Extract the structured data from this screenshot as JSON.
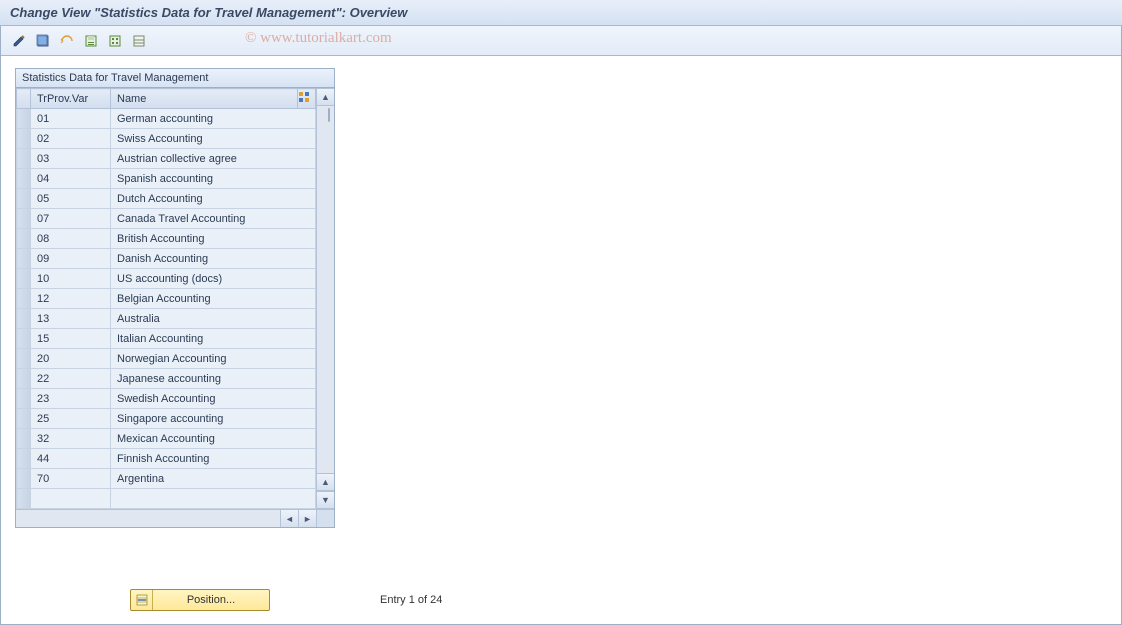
{
  "title": "Change View \"Statistics Data for Travel Management\": Overview",
  "watermark": "© www.tutorialkart.com",
  "panel": {
    "header": "Statistics Data for Travel Management",
    "columns": {
      "c1": "TrProv.Var",
      "c2": "Name"
    },
    "rows": [
      {
        "var": "01",
        "name": "German accounting"
      },
      {
        "var": "02",
        "name": "Swiss Accounting"
      },
      {
        "var": "03",
        "name": "Austrian collective agree"
      },
      {
        "var": "04",
        "name": "Spanish accounting"
      },
      {
        "var": "05",
        "name": "Dutch Accounting"
      },
      {
        "var": "07",
        "name": "Canada Travel Accounting"
      },
      {
        "var": "08",
        "name": "British Accounting"
      },
      {
        "var": "09",
        "name": "Danish Accounting"
      },
      {
        "var": "10",
        "name": "US accounting (docs)"
      },
      {
        "var": "12",
        "name": "Belgian Accounting"
      },
      {
        "var": "13",
        "name": "Australia"
      },
      {
        "var": "15",
        "name": "Italian Accounting"
      },
      {
        "var": "20",
        "name": "Norwegian Accounting"
      },
      {
        "var": "22",
        "name": "Japanese accounting"
      },
      {
        "var": "23",
        "name": "Swedish Accounting"
      },
      {
        "var": "25",
        "name": "Singapore accounting"
      },
      {
        "var": "32",
        "name": "Mexican Accounting"
      },
      {
        "var": "44",
        "name": "Finnish Accounting"
      },
      {
        "var": "70",
        "name": "Argentina"
      }
    ]
  },
  "position_button": "Position...",
  "entry_text": "Entry 1 of 24"
}
